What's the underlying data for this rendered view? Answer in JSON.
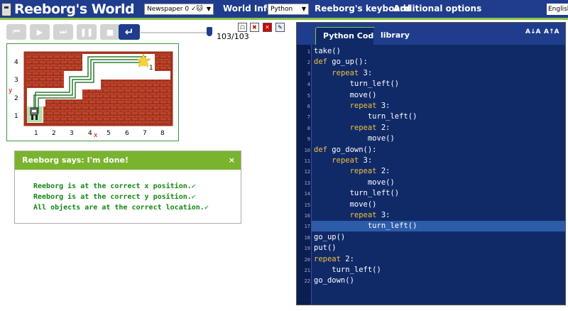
{
  "header": {
    "title": "Reeborg's World",
    "world_selector": "Newspaper 0 ✓🐱",
    "world_info": "World Info",
    "language_selector": "Python",
    "keyboard": "Reeborg's keyboard",
    "options": "Additional options",
    "ui_language": "English"
  },
  "controls": {
    "step_readout": "103/103"
  },
  "world": {
    "x_ticks": [
      "1",
      "2",
      "3",
      "4",
      "5",
      "6",
      "7",
      "8"
    ],
    "y_ticks": [
      "1",
      "2",
      "3",
      "4"
    ],
    "x_label": "x",
    "y_label": "y",
    "goal_count": "1",
    "wall_color": "#a0331c",
    "brick_color": "#c0432a",
    "path_color": "#2e7d32"
  },
  "dialog": {
    "title": "Reeborg says: I'm done!",
    "close": "×",
    "lines": [
      "Reeborg is at the correct x position.",
      "Reeborg is at the correct y position.",
      "All objects are at the correct location."
    ],
    "check_mark": "✔"
  },
  "editor": {
    "tab_code": "Python Code",
    "tab_library": "library",
    "font_decrease": "A↓A",
    "font_increase": "A↑A",
    "highlighted_line": 17,
    "lines": [
      "take()",
      "def go_up():",
      "    repeat 3:",
      "        turn_left()",
      "        move()",
      "        repeat 3:",
      "            turn_left()",
      "        repeat 2:",
      "            move()",
      "def go_down():",
      "    repeat 3:",
      "        repeat 2:",
      "            move()",
      "        turn_left()",
      "        move()",
      "        repeat 3:",
      "            turn_left()",
      "go_up()",
      "put()",
      "repeat 2:",
      "    turn_left()",
      "go_down()"
    ],
    "line_numbers": [
      "1",
      "2",
      "3",
      "4",
      "5",
      "6",
      "7",
      "8",
      "9",
      "10",
      "11",
      "12",
      "13",
      "14",
      "15",
      "16",
      "17",
      "18",
      "19",
      "20",
      "21",
      "22"
    ]
  }
}
